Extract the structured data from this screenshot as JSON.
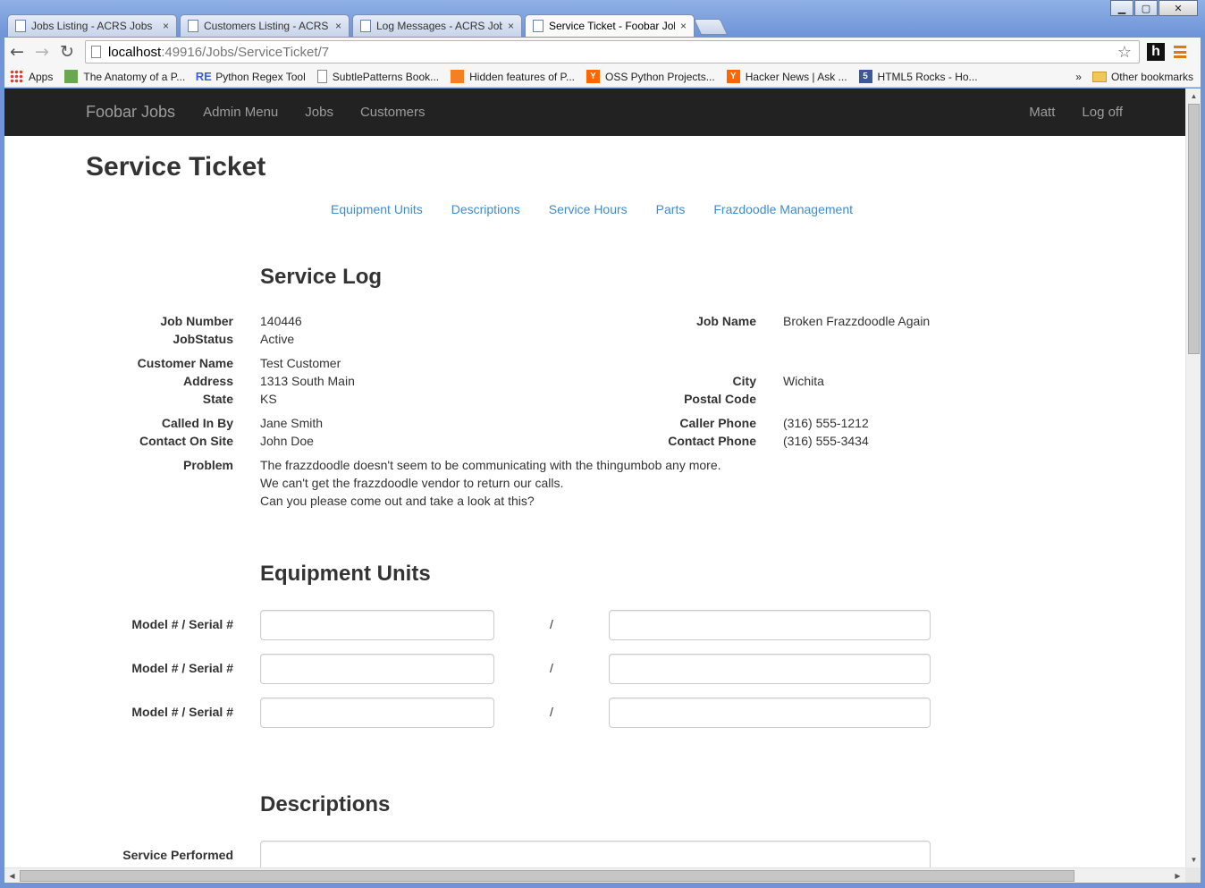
{
  "browser": {
    "tabs": [
      {
        "title": "Jobs Listing - ACRS Jobs",
        "active": false
      },
      {
        "title": "Customers Listing - ACRS",
        "active": false
      },
      {
        "title": "Log Messages - ACRS Jobs",
        "active": false
      },
      {
        "title": "Service Ticket - Foobar Jobs",
        "active": true
      }
    ],
    "tab_close": "×",
    "url_host": "localhost",
    "url_path": ":49916/Jobs/ServiceTicket/7",
    "back_icon": "←",
    "forward_icon": "→",
    "reload_icon": "↻",
    "star_icon": "☆",
    "extension_label": "h",
    "bookmarks": [
      {
        "label": "Apps",
        "icon": "apps-grid-icon",
        "color": "#3c78d8"
      },
      {
        "label": "The Anatomy of a P...",
        "icon": "page-green-icon",
        "color": "#6aa84f"
      },
      {
        "label": "Python Regex Tool",
        "icon": "re-icon",
        "color": "#3d5afe"
      },
      {
        "label": "SubtlePatterns Book...",
        "icon": "page-icon",
        "color": "#ffffff"
      },
      {
        "label": "Hidden features of P...",
        "icon": "stack-overflow-icon",
        "color": "#f48024"
      },
      {
        "label": "OSS Python Projects...",
        "icon": "y-combinator-icon",
        "color": "#ff6600"
      },
      {
        "label": "Hacker News | Ask ...",
        "icon": "y-combinator-icon",
        "color": "#ff6600"
      },
      {
        "label": "HTML5 Rocks - Ho...",
        "icon": "html5-icon",
        "color": "#3b5998"
      }
    ],
    "bookmarks_overflow": "»",
    "other_bookmarks": "Other bookmarks",
    "window_controls": {
      "minimize": "▁",
      "maximize": "▢",
      "close": "✕"
    }
  },
  "navbar": {
    "brand": "Foobar Jobs",
    "links": [
      "Admin Menu",
      "Jobs",
      "Customers"
    ],
    "user": "Matt",
    "logoff": "Log off",
    "bg_color": "#222222"
  },
  "page": {
    "title": "Service Ticket",
    "subnav": [
      "Equipment Units",
      "Descriptions",
      "Service Hours",
      "Parts",
      "Frazdoodle Management"
    ],
    "link_color": "#428bca"
  },
  "service_log": {
    "heading": "Service Log",
    "job_number_label": "Job Number",
    "job_number": "140446",
    "job_status_label": "JobStatus",
    "job_status": "Active",
    "job_name_label": "Job Name",
    "job_name": "Broken Frazzdoodle Again",
    "customer_name_label": "Customer Name",
    "customer_name": "Test Customer",
    "address_label": "Address",
    "address": "1313 South Main",
    "city_label": "City",
    "city": "Wichita",
    "state_label": "State",
    "state": "KS",
    "postal_code_label": "Postal Code",
    "postal_code": "",
    "called_in_by_label": "Called In By",
    "called_in_by": "Jane Smith",
    "caller_phone_label": "Caller Phone",
    "caller_phone": "(316) 555-1212",
    "contact_on_site_label": "Contact On Site",
    "contact_on_site": "John Doe",
    "contact_phone_label": "Contact Phone",
    "contact_phone": "(316) 555-3434",
    "problem_label": "Problem",
    "problem_lines": [
      "The frazzdoodle doesn't seem to be communicating with the thingumbob any more.",
      "We can't get the frazzdoodle vendor to return our calls.",
      "Can you please come out and take a look at this?"
    ]
  },
  "equipment_units": {
    "heading": "Equipment Units",
    "rows": [
      {
        "label": "Model # / Serial #",
        "separator": "/",
        "model": "",
        "serial": ""
      },
      {
        "label": "Model # / Serial #",
        "separator": "/",
        "model": "",
        "serial": ""
      },
      {
        "label": "Model # / Serial #",
        "separator": "/",
        "model": "",
        "serial": ""
      }
    ]
  },
  "descriptions": {
    "heading": "Descriptions",
    "service_performed_label": "Service Performed",
    "service_performed": ""
  }
}
